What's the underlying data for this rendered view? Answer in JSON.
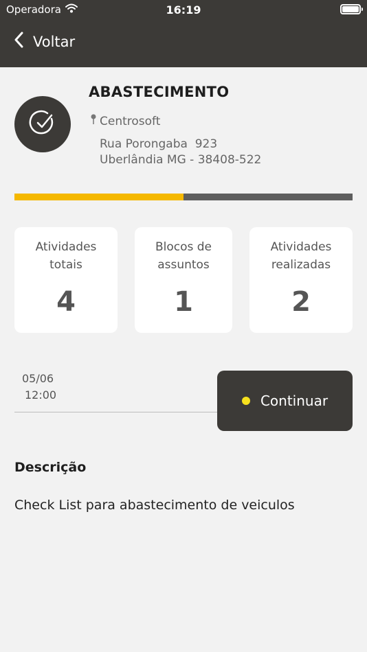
{
  "status_bar": {
    "carrier": "Operadora",
    "time": "16:19"
  },
  "header": {
    "back_label": "Voltar"
  },
  "activity": {
    "title": "ABASTECIMENTO",
    "location_name": "Centrosoft",
    "address_line1": "Rua Porongaba  923",
    "address_line2": "Uberlândia MG - 38408-522",
    "progress_fraction": 0.5
  },
  "stats": [
    {
      "label": "Atividades totais",
      "value": "4"
    },
    {
      "label": "Blocos de assuntos",
      "value": "1"
    },
    {
      "label": "Atividades realizadas",
      "value": "2"
    }
  ],
  "schedule": {
    "date": "05/06",
    "time": "12:00"
  },
  "continue_button": {
    "label": "Continuar"
  },
  "description": {
    "heading": "Descrição",
    "text": "Check List para abastecimento de veiculos"
  },
  "colors": {
    "header_bg": "#3c3a37",
    "progress_fill": "#f5b800",
    "progress_track": "#5e5e5e",
    "button_dot": "#f7e11e",
    "page_bg": "#f2f2f2"
  },
  "icons": [
    "wifi-icon",
    "battery-icon",
    "back-chevron-icon",
    "check-circle-icon",
    "location-pin-icon"
  ]
}
